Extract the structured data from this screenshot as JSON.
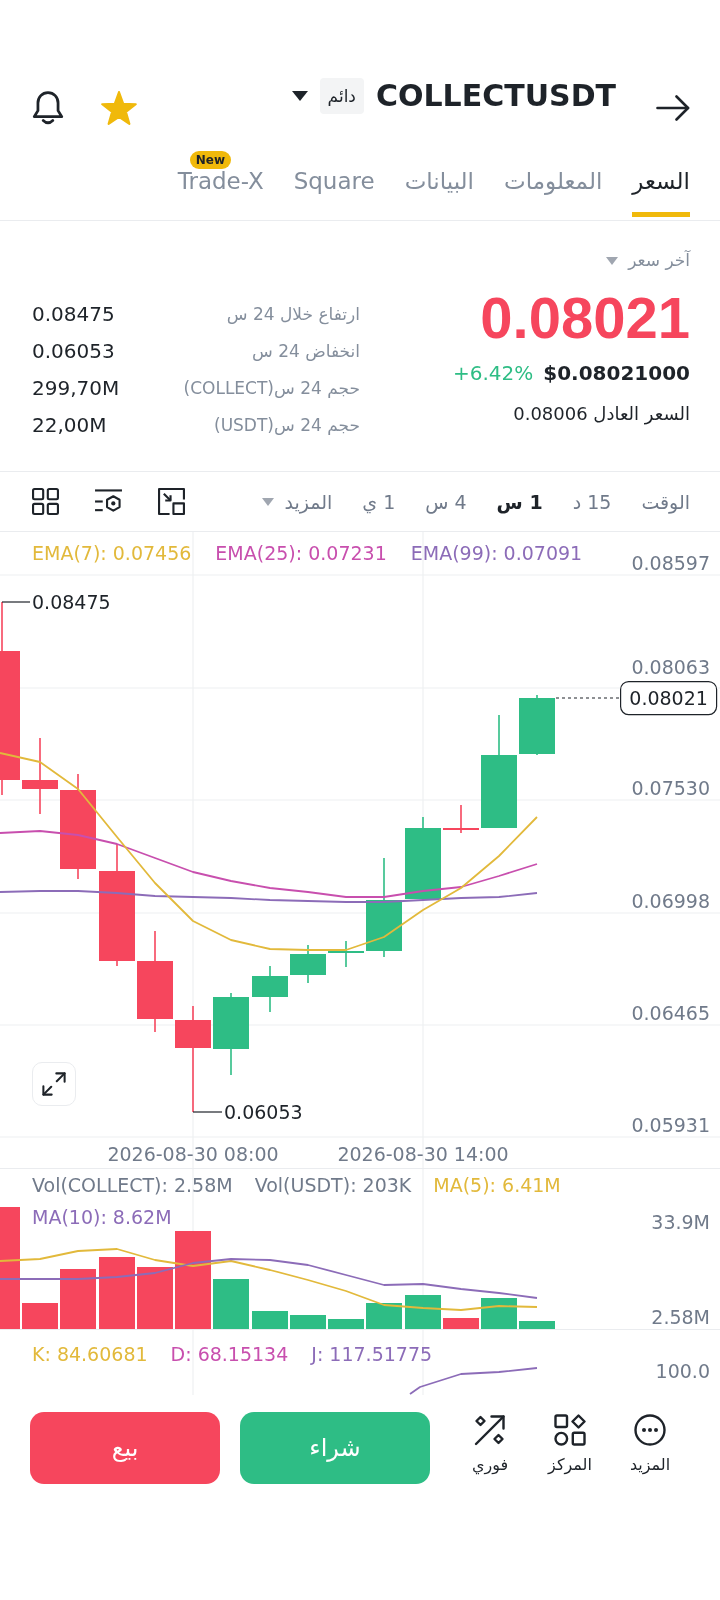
{
  "header": {
    "symbol": "COLLECTUSDT",
    "contract_type": "دائم"
  },
  "tabs": [
    {
      "label": "السعر",
      "selected": true
    },
    {
      "label": "المعلومات",
      "selected": false
    },
    {
      "label": "البيانات",
      "selected": false
    },
    {
      "label": "Square",
      "selected": false
    },
    {
      "label": "Trade-X",
      "selected": false,
      "badge": "New"
    }
  ],
  "price": {
    "type_selector": "آخر سعر",
    "last_price": "0.08021",
    "usd_price": "$0.08021000",
    "change": "+6.42%",
    "fair_price": "السعر العادل 0.08006"
  },
  "stats": [
    {
      "label": "ارتفاع خلال 24 س",
      "value": "0.08475"
    },
    {
      "label": "انخفاض 24 س",
      "value": "0.06053"
    },
    {
      "label": "حجم 24 س(COLLECT)",
      "value": "299,70M"
    },
    {
      "label": "حجم 24 س(USDT)",
      "value": "22,00M"
    }
  ],
  "intervals": [
    {
      "label": "الوقت",
      "selected": false
    },
    {
      "label": "15 د",
      "selected": false
    },
    {
      "label": "1 س",
      "selected": true
    },
    {
      "label": "4 س",
      "selected": false
    },
    {
      "label": "1 ي",
      "selected": false
    }
  ],
  "more_intervals": "المزيد",
  "price_chart": {
    "legend": [
      {
        "text": "EMA(99): 0.07091",
        "color": "#8c6cb8"
      },
      {
        "text": "EMA(25): 0.07231",
        "color": "#c84fae"
      },
      {
        "text": "EMA(7): 0.07456",
        "color": "#e2b93b"
      }
    ],
    "y_axis": [
      "0.08597",
      "0.08063",
      "0.07530",
      "0.06998",
      "0.06465",
      "0.05931"
    ],
    "high_label": "0.08475",
    "current_price": "0.08021",
    "low_label": "0.06053",
    "x_axis": [
      "2026-08-30 14:00",
      "2026-08-30 08:00"
    ]
  },
  "volume_chart": {
    "legend_rows": [
      {
        "items": [
          {
            "text": "MA(5): 6.41M",
            "color": "#e2b93b"
          },
          {
            "text": "Vol(USDT): 203K",
            "color": "#707a8a"
          },
          {
            "text": "Vol(COLLECT): 2.58M",
            "color": "#707a8a"
          }
        ]
      },
      {
        "items": [
          {
            "text": "MA(10): 8.62M",
            "color": "#8c6cb8"
          }
        ]
      }
    ],
    "y_axis": [
      "33.9M",
      "2.58M"
    ]
  },
  "kdj_chart": {
    "legend": [
      {
        "text": "J: 117.51775",
        "color": "#8c6cb8"
      },
      {
        "text": "D: 68.15134",
        "color": "#c84fae"
      },
      {
        "text": "K: 84.60681",
        "color": "#e2b93b"
      }
    ],
    "y_axis": [
      "100.0"
    ]
  },
  "actions": {
    "tools": [
      {
        "kind": "more",
        "label": "المزيد"
      },
      {
        "kind": "position",
        "label": "المركز"
      },
      {
        "kind": "instant",
        "label": "فوري"
      }
    ],
    "buy": "شراء",
    "sell": "بيع"
  }
}
